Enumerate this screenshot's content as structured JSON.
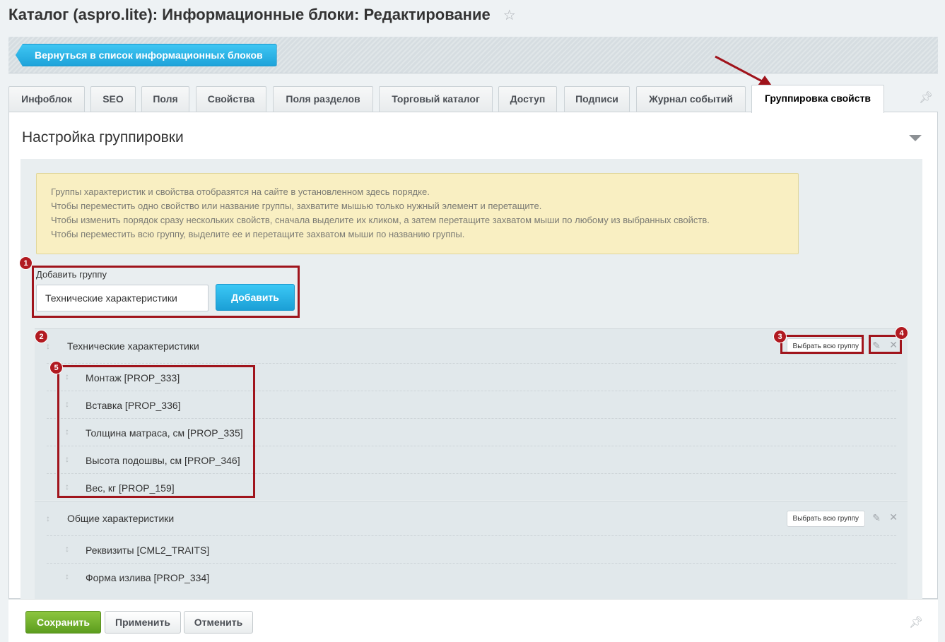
{
  "header": {
    "title": "Каталог (aspro.lite): Информационные блоки: Редактирование",
    "star_icon": "star-icon"
  },
  "back_button": {
    "label": "Вернуться в список информационных блоков"
  },
  "tabs": [
    {
      "label": "Инфоблок"
    },
    {
      "label": "SEO"
    },
    {
      "label": "Поля"
    },
    {
      "label": "Свойства"
    },
    {
      "label": "Поля разделов"
    },
    {
      "label": "Торговый каталог"
    },
    {
      "label": "Доступ"
    },
    {
      "label": "Подписи"
    },
    {
      "label": "Журнал событий"
    },
    {
      "label": "Группировка свойств",
      "active": true
    }
  ],
  "section": {
    "title": "Настройка группировки"
  },
  "hint": {
    "lines": [
      "Группы характеристик и свойства отобразятся на сайте в установленном здесь порядке.",
      "Чтобы переместить одно свойство или название группы, захватите мышью только нужный элемент и перетащите.",
      "Чтобы изменить порядок сразу нескольких свойств, сначала выделите их кликом, а затем перетащите захватом мыши по любому из выбранных свойств.",
      "Чтобы переместить всю группу, выделите ее и перетащите захватом мыши по названию группы."
    ]
  },
  "add_group": {
    "label": "Добавить группу",
    "input_value": "Технические характеристики",
    "button_label": "Добавить"
  },
  "groups": [
    {
      "name": "Технические характеристики",
      "select_all_label": "Выбрать всю группу",
      "properties": [
        "Монтаж [PROP_333]",
        "Вставка [PROP_336]",
        "Толщина матраса, см [PROP_335]",
        "Высота подошвы, см [PROP_346]",
        "Вес, кг [PROP_159]"
      ]
    },
    {
      "name": "Общие характеристики",
      "select_all_label": "Выбрать всю группу",
      "properties": [
        "Реквизиты [CML2_TRAITS]",
        "Форма излива [PROP_334]"
      ]
    }
  ],
  "badges": [
    "1",
    "2",
    "3",
    "4",
    "5"
  ],
  "footer": {
    "save_label": "Сохранить",
    "apply_label": "Применить",
    "cancel_label": "Отменить"
  },
  "colors": {
    "accent_blue": "#1ea3da",
    "save_green": "#5c9d1e",
    "highlight_red": "#a0141c",
    "hint_bg": "#f9efc2"
  }
}
